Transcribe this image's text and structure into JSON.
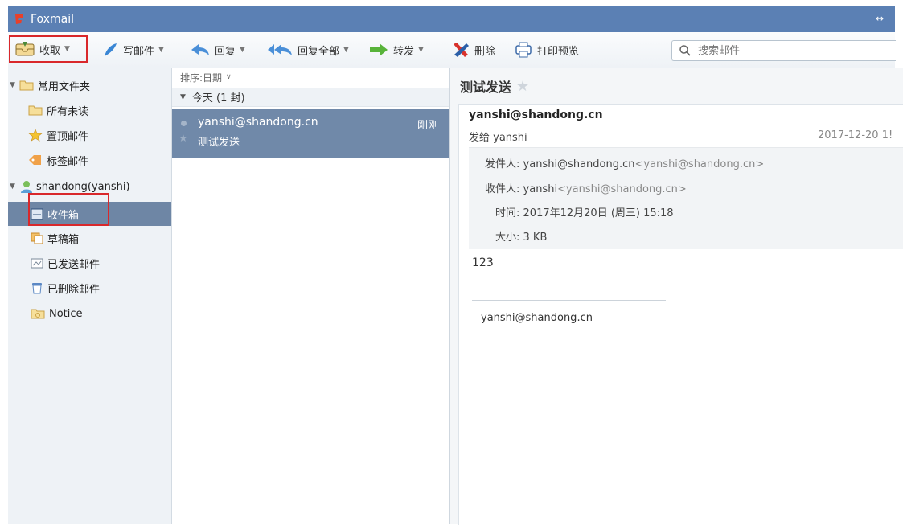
{
  "window": {
    "app_title": "Foxmail",
    "resize_glyph": "↔"
  },
  "toolbar": {
    "receive": "收取",
    "compose": "写邮件",
    "reply": "回复",
    "reply_all": "回复全部",
    "forward": "转发",
    "delete": "删除",
    "print_preview": "打印预览"
  },
  "search": {
    "placeholder": "搜索邮件"
  },
  "sidebar": {
    "common_group": "常用文件夹",
    "common_items": [
      "所有未读",
      "置顶邮件",
      "标签邮件"
    ],
    "account": "shandong(yanshi)",
    "account_items": [
      "收件箱",
      "草稿箱",
      "已发送邮件",
      "已删除邮件",
      "Notice"
    ],
    "selected": "收件箱"
  },
  "list": {
    "sort_label": "排序:日期",
    "group_label": "今天 (1 封)",
    "items": [
      {
        "from": "yanshi@shandong.cn",
        "time": "刚刚",
        "subject": "测试发送"
      }
    ]
  },
  "reader": {
    "subject": "测试发送",
    "sender_address": "yanshi@shandong.cn",
    "to_line": "发给 yanshi",
    "date_short": "2017-12-20 1!",
    "details": {
      "from_label": "发件人:",
      "from_name": "yanshi@shandong.cn",
      "from_addr": "<yanshi@shandong.cn>",
      "to_label": "收件人:",
      "to_name": "yanshi",
      "to_addr": "<yanshi@shandong.cn>",
      "time_label": "时间:",
      "time_value": "2017年12月20日 (周三) 15:18",
      "size_label": "大小:",
      "size_value": "3 KB"
    },
    "body": "123",
    "signature": "yanshi@shandong.cn"
  },
  "colors": {
    "titlebar": "#5b80b4",
    "selection": "#6e86a5",
    "highlight": "#d9282b"
  },
  "icons": [
    "foxmail-logo-icon",
    "receive-icon",
    "compose-icon",
    "reply-icon",
    "reply-all-icon",
    "forward-icon",
    "delete-icon",
    "print-icon",
    "search-icon",
    "folder-icon",
    "star-icon",
    "tag-icon",
    "account-icon",
    "inbox-icon",
    "drafts-icon",
    "sent-icon",
    "trash-icon",
    "notice-folder-icon"
  ]
}
